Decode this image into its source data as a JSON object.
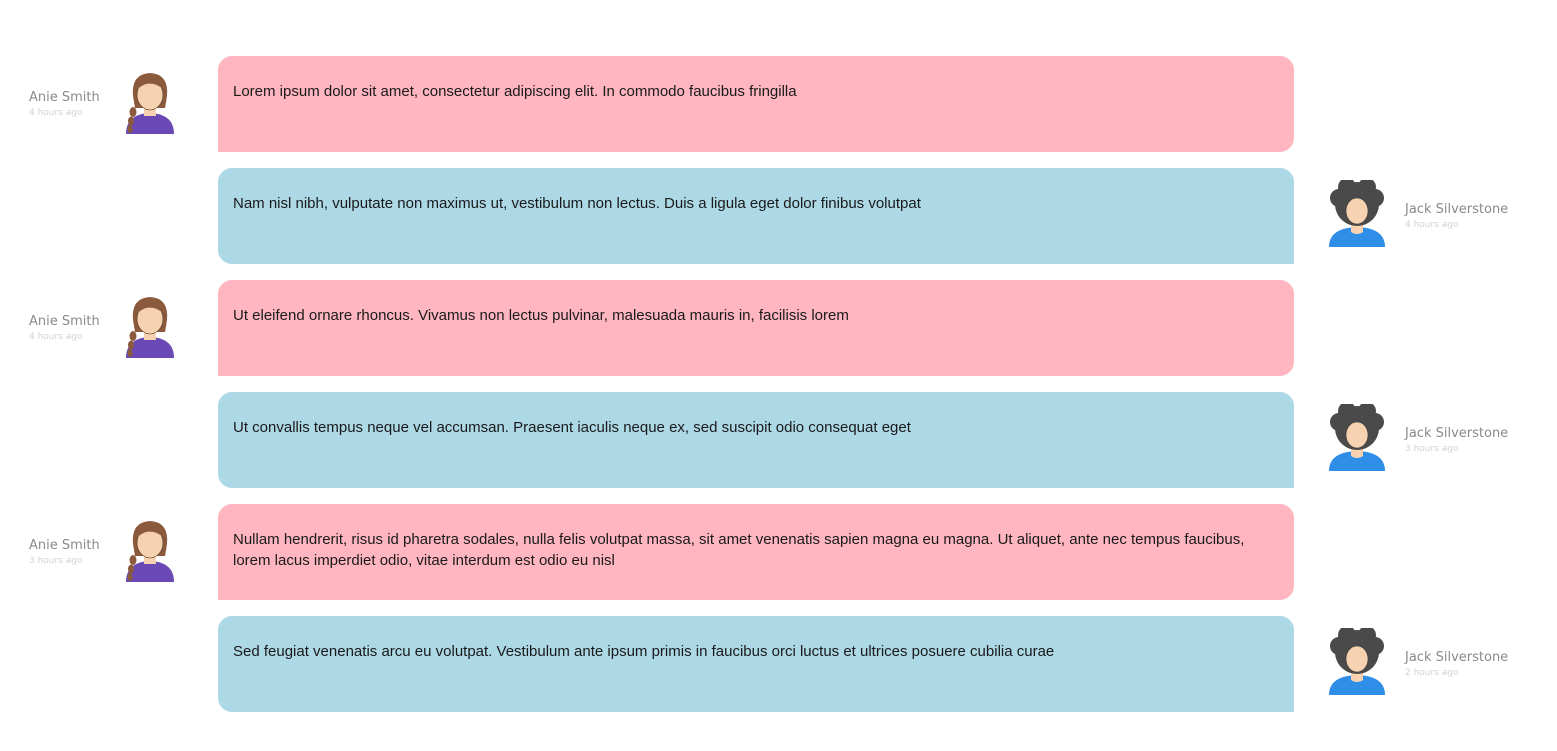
{
  "messages": [
    {
      "side": "left",
      "author": "Anie Smith",
      "time": "4 hours ago",
      "text": "Lorem ipsum dolor sit amet, consectetur adipiscing elit. In commodo faucibus fringilla",
      "avatar": "female-avatar-icon"
    },
    {
      "side": "right",
      "author": "Jack Silverstone",
      "time": "4 hours ago",
      "text": "Nam nisl nibh, vulputate non maximus ut, vestibulum non lectus. Duis a ligula eget dolor finibus volutpat",
      "avatar": "male-avatar-icon"
    },
    {
      "side": "left",
      "author": "Anie Smith",
      "time": "4 hours ago",
      "text": "Ut eleifend ornare rhoncus. Vivamus non lectus pulvinar, malesuada mauris in, facilisis lorem",
      "avatar": "female-avatar-icon"
    },
    {
      "side": "right",
      "author": "Jack Silverstone",
      "time": "3 hours ago",
      "text": "Ut convallis tempus neque vel accumsan. Praesent iaculis neque ex, sed suscipit odio consequat eget",
      "avatar": "male-avatar-icon"
    },
    {
      "side": "left",
      "author": "Anie Smith",
      "time": "3 hours ago",
      "text": "Nullam hendrerit, risus id pharetra sodales, nulla felis volutpat massa, sit amet venenatis sapien magna eu magna. Ut aliquet, ante nec tempus faucibus, lorem lacus imperdiet odio, vitae interdum est odio eu nisl",
      "avatar": "female-avatar-icon"
    },
    {
      "side": "right",
      "author": "Jack Silverstone",
      "time": "2 hours ago",
      "text": "Sed feugiat venenatis arcu eu volutpat. Vestibulum ante ipsum primis in faucibus orci luctus et ultrices posuere cubilia curae",
      "avatar": "male-avatar-icon"
    }
  ],
  "colors": {
    "left_bubble": "#ffb6c1",
    "right_bubble": "#add8e6",
    "name_text": "#8a8a8a",
    "time_text": "#d2d2d2",
    "female_shirt": "#6a48b5",
    "male_shirt": "#2f8fe8"
  }
}
